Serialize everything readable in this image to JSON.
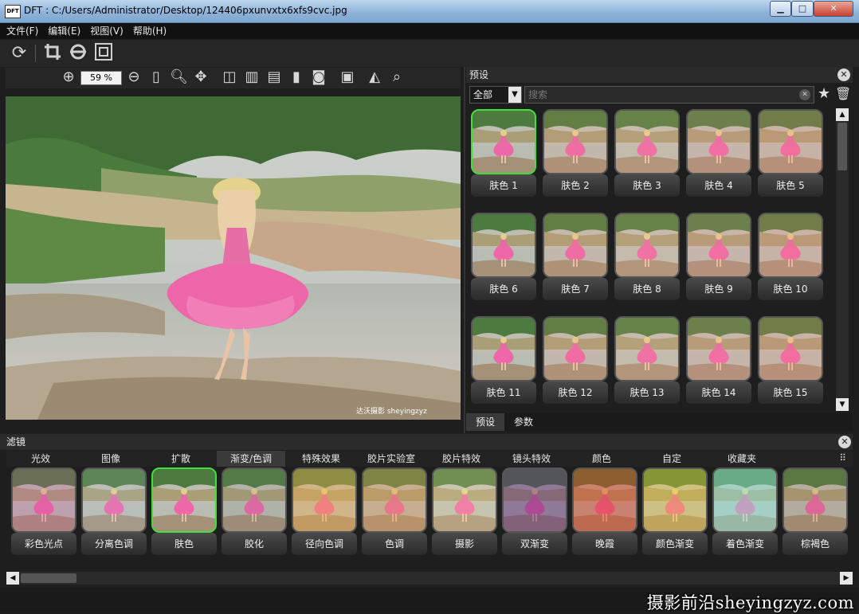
{
  "window": {
    "app_icon": "DFT",
    "title": "DFT : C:/Users/Administrator/Desktop/124406pxunvxtx6xfs9cvc.jpg",
    "minimize": "▁",
    "maximize": "□",
    "close": "✕"
  },
  "menu": [
    "文件(F)",
    "编辑(E)",
    "视图(V)",
    "帮助(H)"
  ],
  "toolbar": {
    "zoom_value": "59 %"
  },
  "presets": {
    "title": "预设",
    "filter_value": "全部",
    "search_placeholder": "搜索",
    "items": [
      "肤色 1",
      "肤色 2",
      "肤色 3",
      "肤色 4",
      "肤色 5",
      "肤色 6",
      "肤色 7",
      "肤色 8",
      "肤色 9",
      "肤色 10",
      "肤色 11",
      "肤色 12",
      "肤色 13",
      "肤色 14",
      "肤色 15"
    ],
    "selected_index": 0,
    "tabs": [
      "预设",
      "参数"
    ]
  },
  "filters": {
    "title": "滤镜",
    "categories": [
      "光效",
      "图像",
      "扩散",
      "渐变/色调",
      "特殊效果",
      "胶片实验室",
      "胶片特效",
      "镜头特效",
      "颜色",
      "自定",
      "收藏夹"
    ],
    "active_category": 3,
    "items": [
      "彩色光点",
      "分离色调",
      "肤色",
      "胶化",
      "径向色调",
      "色调",
      "摄影",
      "双渐变",
      "晚霞",
      "颜色渐变",
      "着色渐变",
      "棕褐色"
    ],
    "selected_index": 2
  },
  "photo_caption": "达沃摄影 sheyingzyz",
  "watermark": "摄影前沿sheyingzyz.com",
  "colors": {
    "selection_green": "#3ee03a",
    "background": "#1e1e1e"
  }
}
